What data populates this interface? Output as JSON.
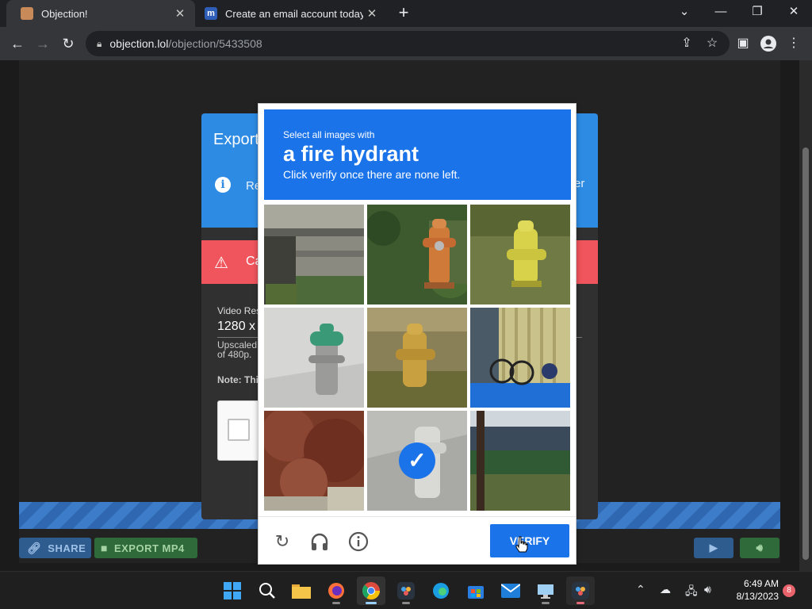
{
  "browser": {
    "tabs": [
      {
        "title": "Objection!",
        "active": true
      },
      {
        "title": "Create an email account today at",
        "active": false
      }
    ],
    "close_glyph": "✕",
    "new_tab_glyph": "+",
    "url_host": "objection.lol",
    "url_path": "/objection/5433508",
    "window_controls": [
      "⌄",
      "—",
      "❐",
      "✕"
    ]
  },
  "export_modal": {
    "title": "Export",
    "info_icon": "i",
    "info_text": "Re lin",
    "info_right": "er",
    "warning_text": "Ca",
    "video_res_label": "Video Res",
    "resolution_value": "1280 x",
    "upscale_help": "Upscaled of 480p.",
    "note": "Note: Thi"
  },
  "captcha": {
    "instruction_line1": "Select all images with",
    "target": "a fire hydrant",
    "instruction_line3": "Click verify once there are none left.",
    "verify_label": "VERIFY",
    "tiles": [
      {
        "subject": "street-rail",
        "selected": false
      },
      {
        "subject": "orange-hydrant",
        "selected": false
      },
      {
        "subject": "yellow-hydrant-grass",
        "selected": false
      },
      {
        "subject": "grey-hydrant-green-cap",
        "selected": false
      },
      {
        "subject": "yellow-hydrant-lawn",
        "selected": false
      },
      {
        "subject": "bicycle-fence",
        "selected": false
      },
      {
        "subject": "autumn-tree",
        "selected": false
      },
      {
        "subject": "white-hydrant",
        "selected": true
      },
      {
        "subject": "house-trees",
        "selected": false
      }
    ]
  },
  "controls": {
    "share_label": "SHARE",
    "export_label": "EXPORT MP4"
  },
  "taskbar": {
    "time": "6:49 AM",
    "date": "8/13/2023",
    "notifications": "8"
  },
  "colors": {
    "captcha_blue": "#1a73e8",
    "modal_blue": "#2d8be3",
    "warning_red": "#f0545c"
  }
}
